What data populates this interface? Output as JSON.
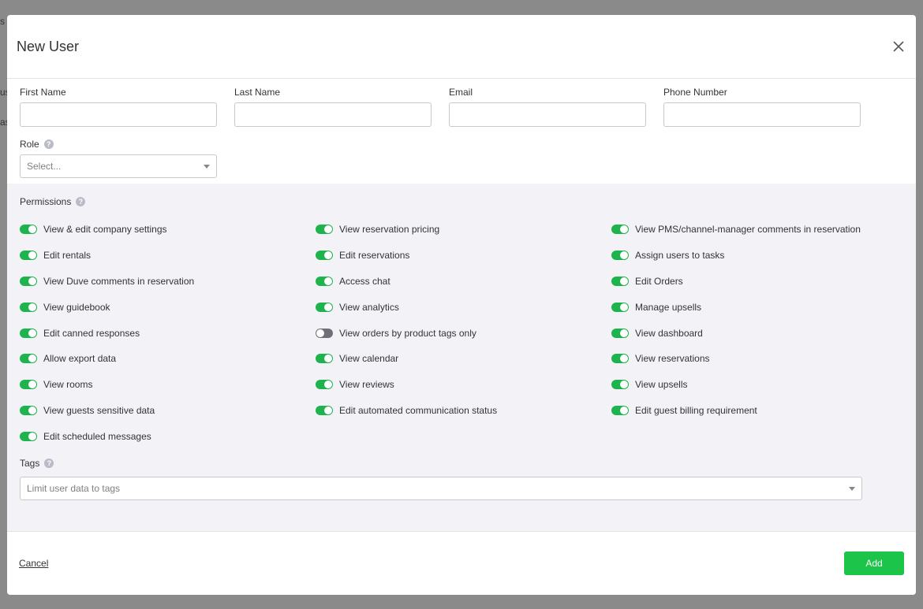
{
  "background": {
    "fragments": [
      "s a",
      "us",
      "as"
    ]
  },
  "modal": {
    "title": "New User",
    "close_icon": "close-icon"
  },
  "fields": {
    "first_name": {
      "label": "First Name",
      "value": ""
    },
    "last_name": {
      "label": "Last Name",
      "value": ""
    },
    "email": {
      "label": "Email",
      "value": ""
    },
    "phone": {
      "label": "Phone Number",
      "value": ""
    },
    "role": {
      "label": "Role",
      "placeholder": "Select..."
    }
  },
  "permissions": {
    "title": "Permissions",
    "columns": [
      [
        {
          "label": "View & edit company settings",
          "on": true
        },
        {
          "label": "Edit rentals",
          "on": true
        },
        {
          "label": "View Duve comments in reservation",
          "on": true
        },
        {
          "label": "View guidebook",
          "on": true
        },
        {
          "label": "Edit canned responses",
          "on": true
        },
        {
          "label": "Allow export data",
          "on": true
        },
        {
          "label": "View rooms",
          "on": true
        },
        {
          "label": "View guests sensitive data",
          "on": true
        },
        {
          "label": "Edit scheduled messages",
          "on": true
        }
      ],
      [
        {
          "label": "View reservation pricing",
          "on": true
        },
        {
          "label": "Edit reservations",
          "on": true
        },
        {
          "label": "Access chat",
          "on": true
        },
        {
          "label": "View analytics",
          "on": true
        },
        {
          "label": "View orders by product tags only",
          "on": false
        },
        {
          "label": "View calendar",
          "on": true
        },
        {
          "label": "View reviews",
          "on": true
        },
        {
          "label": "Edit automated communication status",
          "on": true
        }
      ],
      [
        {
          "label": "View PMS/channel-manager comments in reservation",
          "on": true
        },
        {
          "label": "Assign users to tasks",
          "on": true
        },
        {
          "label": "Edit Orders",
          "on": true
        },
        {
          "label": "Manage upsells",
          "on": true
        },
        {
          "label": "View dashboard",
          "on": true
        },
        {
          "label": "View reservations",
          "on": true
        },
        {
          "label": "View upsells",
          "on": true
        },
        {
          "label": "Edit guest billing requirement",
          "on": true
        }
      ]
    ]
  },
  "tags": {
    "label": "Tags",
    "placeholder": "Limit user data to tags"
  },
  "footer": {
    "cancel_label": "Cancel",
    "add_label": "Add"
  },
  "colors": {
    "toggle_on": "#1fb34d",
    "toggle_off": "#6f6f78",
    "add_button": "#1cc449"
  }
}
